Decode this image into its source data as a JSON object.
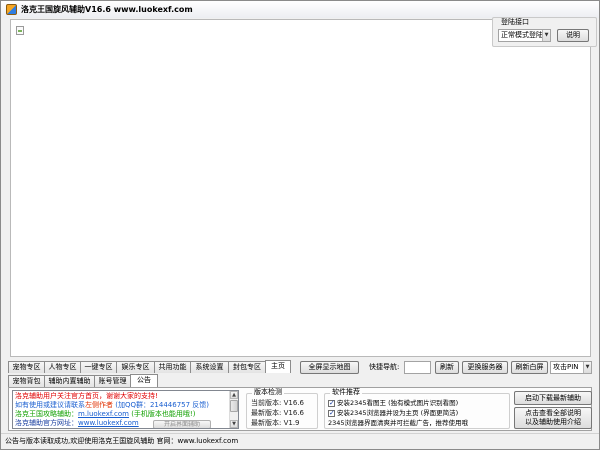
{
  "window": {
    "title": "洛克王国旋风辅助V16.6 www.luokexf.com",
    "icon": "app-icon"
  },
  "login": {
    "group_label": "登陆接口",
    "mode_selected": "正常模式登陆",
    "help_label": "说明"
  },
  "browser": {
    "icon": "broken-image-icon"
  },
  "nav_tabs": [
    {
      "label": "宠物专区",
      "active": false
    },
    {
      "label": "人物专区",
      "active": false
    },
    {
      "label": "一键专区",
      "active": false
    },
    {
      "label": "娱乐专区",
      "active": false
    },
    {
      "label": "共用功能",
      "active": false
    },
    {
      "label": "系统设置",
      "active": false
    },
    {
      "label": "封包专区",
      "active": false
    },
    {
      "label": "主页",
      "active": true
    }
  ],
  "toolbar": {
    "fullscreen_map_label": "全屏显示地图",
    "quick_nav_label": "快捷导航:",
    "quick_nav_value": "",
    "refresh_label": "刷新",
    "change_server_label": "更换服务器",
    "refresh_white_label": "刷新白屏",
    "pin_label": "攻击PIN"
  },
  "sub_tabs": [
    {
      "label": "宠物背包",
      "active": false
    },
    {
      "label": "辅助内置辅助",
      "active": false
    },
    {
      "label": "账号管理",
      "active": false
    },
    {
      "label": "公告",
      "active": true
    }
  ],
  "notice": {
    "lines": [
      {
        "segments": [
          {
            "text": "洛克辅助用户关注官方首页，谢谢大家的支持!",
            "color": "#e00000"
          }
        ]
      },
      {
        "segments": [
          {
            "text": "如有使用或建议请联系",
            "color": "#1a5fd0"
          },
          {
            "text": "左侧作者",
            "color": "#e03000"
          },
          {
            "text": " (加QQ群：214446757 反馈)",
            "color": "#1a5fd0"
          }
        ]
      },
      {
        "segments": [
          {
            "text": "洛克王国攻略辅助：",
            "color": "#11a000"
          },
          {
            "text": "m.luokexf.com",
            "color": "#1a5fd0"
          },
          {
            "text": " (手机版本也能用哦!)",
            "color": "#11a000"
          }
        ]
      },
      {
        "segments": [
          {
            "text": "洛克辅助官方网址：",
            "color": "#1a3fa0"
          },
          {
            "text": "www.luokexf.com",
            "color": "#1a5fd0"
          }
        ]
      }
    ],
    "open_button_label": "开启界面辅助"
  },
  "version": {
    "group_label": "版本检测",
    "lines": [
      "当前版本: V16.6",
      "最新版本: V16.6",
      "最新版本: V1.9"
    ]
  },
  "recommend": {
    "group_label": "软件推荐",
    "items": [
      {
        "label": "安装2345看图王 (独有模式图片识别看图)",
        "checked": true
      },
      {
        "label": "安装2345浏览器并设为主页 (界面更简洁)",
        "checked": true
      }
    ],
    "note": "2345浏览器界面清爽并可拦截广告，推荐使用哦"
  },
  "actions": {
    "download_label": "启动下载最新辅助",
    "guide_label_line1": "点击查看全部说明",
    "guide_label_line2": "以及辅助使用介绍"
  },
  "status_bar": {
    "text": "公告与版本读取成功,欢迎使用洛克王国旋风辅助 官网：www.luokexf.com"
  }
}
